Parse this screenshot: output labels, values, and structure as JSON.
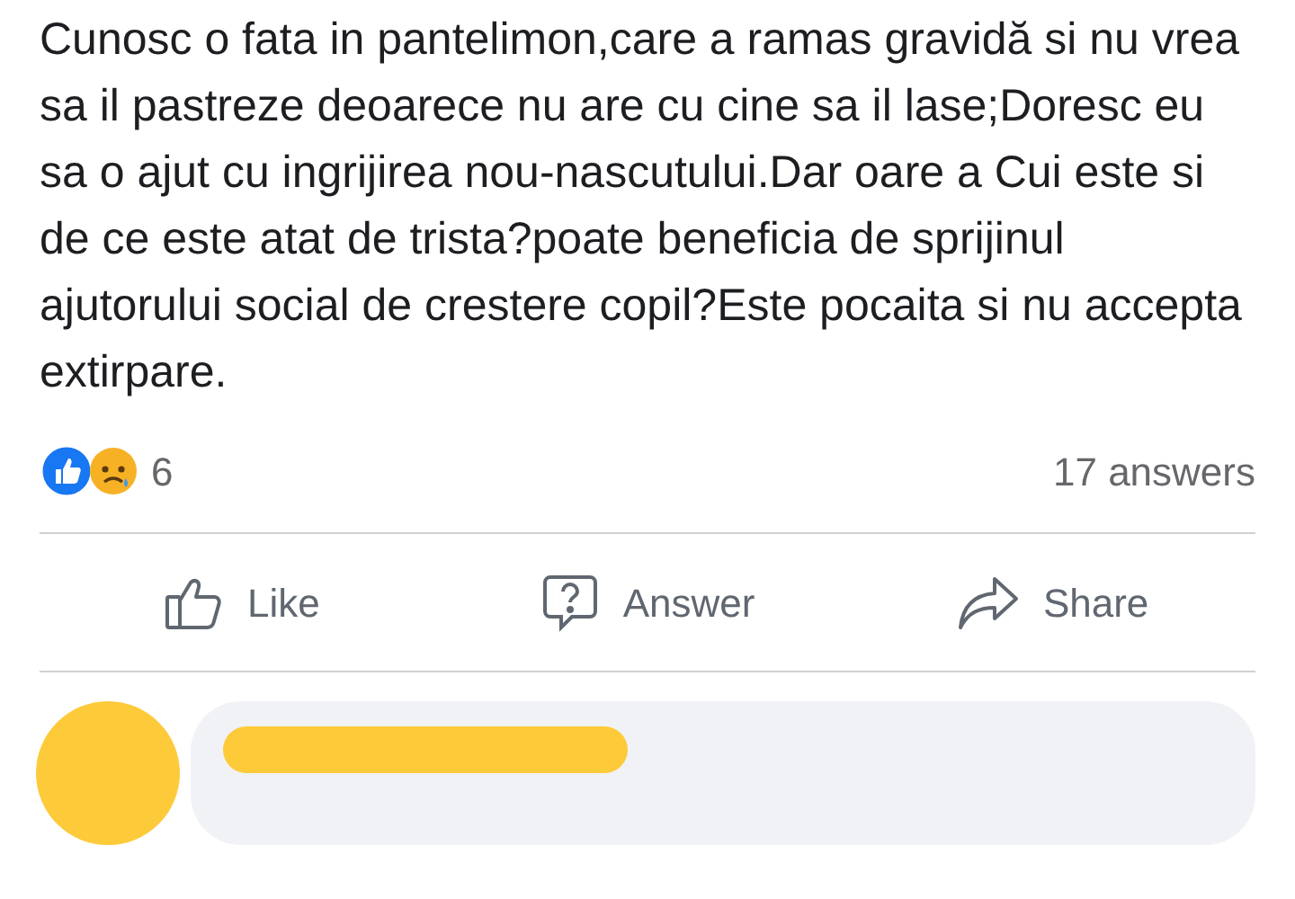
{
  "post": {
    "text": "Cunosc o fata in pantelimon,care a ramas gravidă si nu vrea sa il pastreze deoarece nu are cu cine sa il lase;Doresc eu sa o ajut cu ingrijirea nou-nascutului.Dar oare a Cui este si de ce este atat de trista?poate beneficia de sprijinul ajutorului social de crestere copil?Este pocaita si nu accepta extirpare."
  },
  "reactions": {
    "count": "6",
    "answers": "17 answers"
  },
  "actions": [
    {
      "kind": "like",
      "label": "Like"
    },
    {
      "kind": "answer",
      "label": "Answer"
    },
    {
      "kind": "share",
      "label": "Share"
    }
  ]
}
